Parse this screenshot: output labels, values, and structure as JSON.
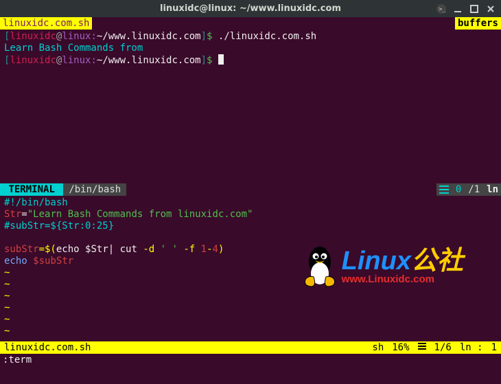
{
  "window": {
    "title": "linuxidc@linux: ~/www.linuxidc.com"
  },
  "buffer_bar": {
    "active_file": "linuxidc.com.sh",
    "right_label": "buffers"
  },
  "terminal": {
    "prompt_user": "linuxidc",
    "prompt_at": "@",
    "prompt_host": "linux:",
    "prompt_path": "~/www.linuxidc.com",
    "prompt_end": "$",
    "command": "./linuxidc.com.sh",
    "output": "Learn Bash Commands from"
  },
  "tabline": {
    "active": "TERMINAL",
    "path": "/bin/bash",
    "pos": "0",
    "total": "/1",
    "ln": "ln"
  },
  "editor": {
    "lines": {
      "l1": "#!/bin/bash",
      "l2_var": "Str",
      "l2_eq": "=",
      "l2_str": "\"Learn Bash Commands from linuxidc.com\"",
      "l3": "#subStr=${Str:0:25}",
      "l5_var": "subStr",
      "l5_eq2": "=$(",
      "l5_cmd": "echo ",
      "l5_sv": "$Str",
      "l5_pipe_cut": "| cut ",
      "l5_d": "-d",
      "l5_q1": " ' '",
      "l5_f": " -f ",
      "l5_num": "1",
      "l5_dash": "-",
      "l5_num2": "4",
      "l5_close": ")",
      "l6_cmd": "echo ",
      "l6_sv": "$subStr",
      "tilde": "~"
    }
  },
  "logo": {
    "main_l": "Linux",
    "main_cn": "公社",
    "sub": "www.Linuxidc.com"
  },
  "airline": {
    "file": "linuxidc.com.sh",
    "filetype": "sh",
    "percent": "16%",
    "ratio": "1/6",
    "ln_label": "ln :",
    "col": "1"
  },
  "cmdline": {
    "text": ":term"
  }
}
